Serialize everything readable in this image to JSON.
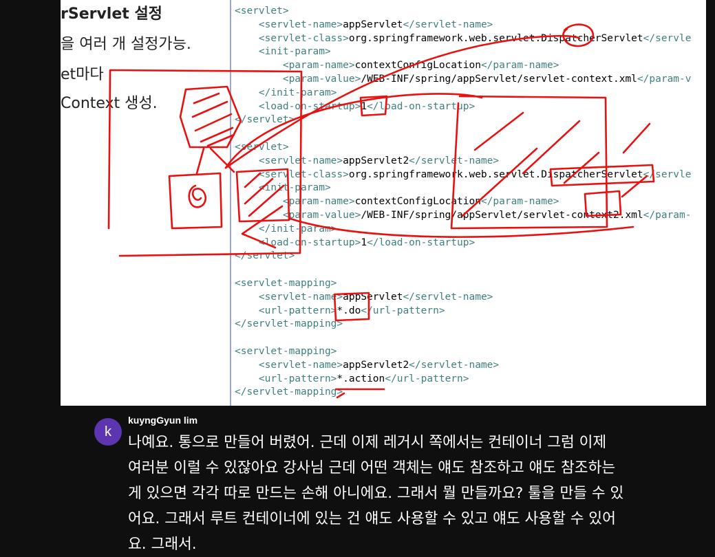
{
  "slide": {
    "left_title": "rServlet 설정",
    "left_lines": [
      "을 여러 개 설정가능.",
      "et마다",
      "Context 생성."
    ]
  },
  "code_lines": [
    [
      {
        "t": "tag",
        "v": "<servlet>"
      }
    ],
    [
      {
        "t": "txt",
        "v": "    "
      },
      {
        "t": "tag",
        "v": "<servlet-name>"
      },
      {
        "t": "txt",
        "v": "appServlet"
      },
      {
        "t": "tag",
        "v": "</servlet-name>"
      }
    ],
    [
      {
        "t": "txt",
        "v": "    "
      },
      {
        "t": "tag",
        "v": "<servlet-class>"
      },
      {
        "t": "txt",
        "v": "org.springframework.web.servlet.DispatcherServlet"
      },
      {
        "t": "tag",
        "v": "</servle"
      }
    ],
    [
      {
        "t": "txt",
        "v": "    "
      },
      {
        "t": "tag",
        "v": "<init-param>"
      }
    ],
    [
      {
        "t": "txt",
        "v": "        "
      },
      {
        "t": "tag",
        "v": "<param-name>"
      },
      {
        "t": "txt",
        "v": "contextConfigLocation"
      },
      {
        "t": "tag",
        "v": "</param-name>"
      }
    ],
    [
      {
        "t": "txt",
        "v": "        "
      },
      {
        "t": "tag",
        "v": "<param-value>"
      },
      {
        "t": "txt",
        "v": "/WEB-INF/spring/appServlet/servlet-context.xml"
      },
      {
        "t": "tag",
        "v": "</param-v"
      }
    ],
    [
      {
        "t": "txt",
        "v": "    "
      },
      {
        "t": "tag",
        "v": "</init-param>"
      }
    ],
    [
      {
        "t": "txt",
        "v": "    "
      },
      {
        "t": "tag",
        "v": "<load-on-startup>"
      },
      {
        "t": "txt",
        "v": "1"
      },
      {
        "t": "tag",
        "v": "</load-on-startup>"
      }
    ],
    [
      {
        "t": "tag",
        "v": "</servlet>"
      }
    ],
    [
      {
        "t": "txt",
        "v": ""
      }
    ],
    [
      {
        "t": "tag",
        "v": "<servlet>"
      }
    ],
    [
      {
        "t": "txt",
        "v": "    "
      },
      {
        "t": "tag",
        "v": "<servlet-name>"
      },
      {
        "t": "txt",
        "v": "appServlet2"
      },
      {
        "t": "tag",
        "v": "</servlet-name>"
      }
    ],
    [
      {
        "t": "txt",
        "v": "    "
      },
      {
        "t": "tag",
        "v": "<servlet-class>"
      },
      {
        "t": "txt",
        "v": "org.springframework.web.servlet.DispatcherServlet"
      },
      {
        "t": "tag",
        "v": "</servle"
      }
    ],
    [
      {
        "t": "txt",
        "v": "    "
      },
      {
        "t": "tag",
        "v": "<init-param>"
      }
    ],
    [
      {
        "t": "txt",
        "v": "        "
      },
      {
        "t": "tag",
        "v": "<param-name>"
      },
      {
        "t": "txt",
        "v": "contextConfigLocation"
      },
      {
        "t": "tag",
        "v": "</param-name>"
      }
    ],
    [
      {
        "t": "txt",
        "v": "        "
      },
      {
        "t": "tag",
        "v": "<param-value>"
      },
      {
        "t": "txt",
        "v": "/WEB-INF/spring/appServlet/servlet-context2.xml"
      },
      {
        "t": "tag",
        "v": "</param-"
      }
    ],
    [
      {
        "t": "txt",
        "v": "    "
      },
      {
        "t": "tag",
        "v": "</init-param>"
      }
    ],
    [
      {
        "t": "txt",
        "v": "    "
      },
      {
        "t": "tag",
        "v": "<load-on-startup>"
      },
      {
        "t": "txt",
        "v": "1"
      },
      {
        "t": "tag",
        "v": "</load-on-startup>"
      }
    ],
    [
      {
        "t": "tag",
        "v": "</servlet>"
      }
    ],
    [
      {
        "t": "txt",
        "v": ""
      }
    ],
    [
      {
        "t": "tag",
        "v": "<servlet-mapping>"
      }
    ],
    [
      {
        "t": "txt",
        "v": "    "
      },
      {
        "t": "tag",
        "v": "<servlet-name>"
      },
      {
        "t": "txt",
        "v": "appServlet"
      },
      {
        "t": "tag",
        "v": "</servlet-name>"
      }
    ],
    [
      {
        "t": "txt",
        "v": "    "
      },
      {
        "t": "tag",
        "v": "<url-pattern>"
      },
      {
        "t": "txt",
        "v": "*.do"
      },
      {
        "t": "tag",
        "v": "</url-pattern>"
      }
    ],
    [
      {
        "t": "tag",
        "v": "</servlet-mapping>"
      }
    ],
    [
      {
        "t": "txt",
        "v": ""
      }
    ],
    [
      {
        "t": "tag",
        "v": "<servlet-mapping>"
      }
    ],
    [
      {
        "t": "txt",
        "v": "    "
      },
      {
        "t": "tag",
        "v": "<servlet-name>"
      },
      {
        "t": "txt",
        "v": "appServlet2"
      },
      {
        "t": "tag",
        "v": "</servlet-name>"
      }
    ],
    [
      {
        "t": "txt",
        "v": "    "
      },
      {
        "t": "tag",
        "v": "<url-pattern>"
      },
      {
        "t": "txt",
        "v": "*.action"
      },
      {
        "t": "tag",
        "v": "</url-pattern>"
      }
    ],
    [
      {
        "t": "tag",
        "v": "</servlet-mapping>"
      }
    ]
  ],
  "comment": {
    "avatar_letter": "k",
    "avatar_color": "#5e35b1",
    "username": "kuyngGyun lim",
    "lines": [
      "나예요. 통으로 만들어 버렸어. 근데 이제 레거시 쪽에서는 컨테이너 그럼 이제",
      "여러분 이럴 수 있잖아요 강사님 근데 어떤 객체는 얘도 참조하고 얘도 참조하는",
      "게 있으면 각각 따로 만드는 손해 아니에요. 그래서 뭘 만들까요? 툴을 만들 수 있",
      "어요. 그래서 루트 컨테이너에 있는 건 얘도 사용할 수 있고 얘도 사용할 수 있어",
      "요. 그래서."
    ]
  },
  "colors": {
    "tag": "#3f7f7f",
    "annotation": "#e8110f",
    "background": "#0f0f0f"
  }
}
